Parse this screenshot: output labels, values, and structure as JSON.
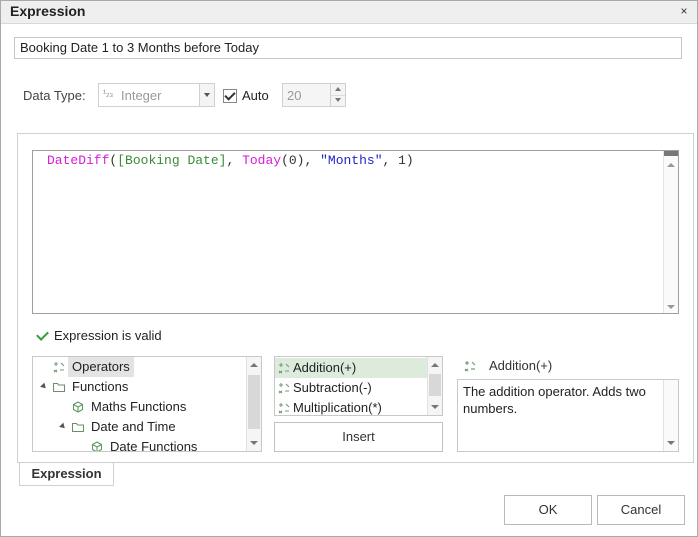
{
  "window": {
    "title": "Expression",
    "close_glyph": "×"
  },
  "name_field": {
    "value": "Booking Date 1 to 3 Months before Today"
  },
  "data_type": {
    "label": "Data Type:",
    "icon_text": "¹₂₃",
    "selected": "Integer",
    "auto_label": "Auto",
    "auto_checked": true,
    "size_value": "20"
  },
  "editor": {
    "tokens": [
      {
        "text": "DateDiff",
        "kind": "fn"
      },
      {
        "text": "(",
        "kind": "punct"
      },
      {
        "text": "[Booking Date]",
        "kind": "field"
      },
      {
        "text": ", ",
        "kind": "punct"
      },
      {
        "text": "Today",
        "kind": "fn"
      },
      {
        "text": "(0), ",
        "kind": "punct"
      },
      {
        "text": "\"Months\"",
        "kind": "str"
      },
      {
        "text": ", 1)",
        "kind": "punct"
      }
    ]
  },
  "validation": {
    "message": "Expression is valid",
    "color": "#3a9b3a"
  },
  "tree": {
    "items": [
      {
        "label": "Operators",
        "icon": "operators-icon",
        "depth": 0,
        "expander": false,
        "selected": true
      },
      {
        "label": "Functions",
        "icon": "folder-icon",
        "depth": 0,
        "expander": true,
        "selected": false
      },
      {
        "label": "Maths Functions",
        "icon": "cube-icon",
        "depth": 1,
        "expander": false,
        "selected": false
      },
      {
        "label": "Date and Time",
        "icon": "folder-icon",
        "depth": 1,
        "expander": true,
        "selected": false
      },
      {
        "label": "Date Functions",
        "icon": "cube-icon",
        "depth": 2,
        "expander": false,
        "selected": false
      }
    ]
  },
  "operators": {
    "items": [
      {
        "label": "Addition(+)",
        "selected": true
      },
      {
        "label": "Subtraction(-)",
        "selected": false
      },
      {
        "label": "Multiplication(*)",
        "selected": false
      }
    ],
    "insert_label": "Insert"
  },
  "description": {
    "title": "Addition(+)",
    "text": "The addition operator. Adds two numbers."
  },
  "tabs": [
    {
      "label": "Expression"
    }
  ],
  "buttons": {
    "ok": "OK",
    "cancel": "Cancel"
  },
  "colors": {
    "function": "#d61cd6",
    "field": "#3a8b36",
    "string": "#2222cc",
    "selection": "#dcebdc"
  }
}
